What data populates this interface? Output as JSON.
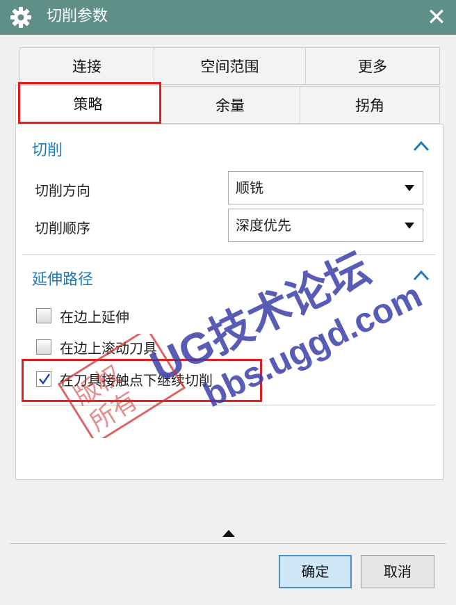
{
  "window": {
    "title": "切削参数",
    "close_symbol": "✕"
  },
  "tabs": {
    "row1": [
      "连接",
      "空间范围",
      "更多"
    ],
    "row2": [
      "策略",
      "余量",
      "拐角"
    ],
    "active": "策略"
  },
  "sections": {
    "cutting": {
      "title": "切削",
      "fields": [
        {
          "label": "切削方向",
          "value": "顺铣"
        },
        {
          "label": "切削顺序",
          "value": "深度优先"
        }
      ]
    },
    "extend_path": {
      "title": "延伸路径",
      "options": [
        {
          "label": "在边上延伸",
          "checked": false
        },
        {
          "label": "在边上滚动刀具",
          "checked": false
        },
        {
          "label": "在刀具接触点下继续切削",
          "checked": true
        }
      ]
    }
  },
  "buttons": {
    "ok": "确定",
    "cancel": "取消"
  },
  "watermark": {
    "line1": "UG技术论坛",
    "line2": "bbs.uggd.com",
    "stamp": "版权所有"
  },
  "colors": {
    "titlebar": "#5f8f87",
    "section_title": "#1f7ab8",
    "highlight": "#e02020",
    "watermark": "#3b3fa8",
    "primary_button": "#cfe6f6"
  }
}
